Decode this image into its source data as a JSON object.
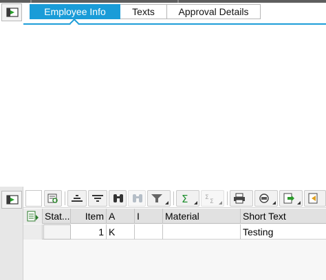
{
  "tabs": [
    {
      "label": "Employee Info",
      "active": true
    },
    {
      "label": "Texts",
      "active": false
    },
    {
      "label": "Approval Details",
      "active": false
    }
  ],
  "toolbar": {
    "buttons": [
      "details-icon",
      "align-center-icon",
      "filter-lines-icon",
      "find-icon",
      "find-next-icon",
      "filter-icon",
      "sum-icon",
      "subtotal-icon",
      "print-icon",
      "views-icon",
      "export-icon",
      "settings-icon"
    ]
  },
  "grid": {
    "columns": [
      "Stat...",
      "Item",
      "A",
      "I",
      "Material",
      "Short Text"
    ],
    "rows": [
      {
        "status": "",
        "item": "1",
        "a": "K",
        "i": "",
        "material": "",
        "short_text": "Testing"
      }
    ]
  },
  "colors": {
    "accent": "#1a9cd8",
    "header_bg": "#e1e1e1"
  }
}
